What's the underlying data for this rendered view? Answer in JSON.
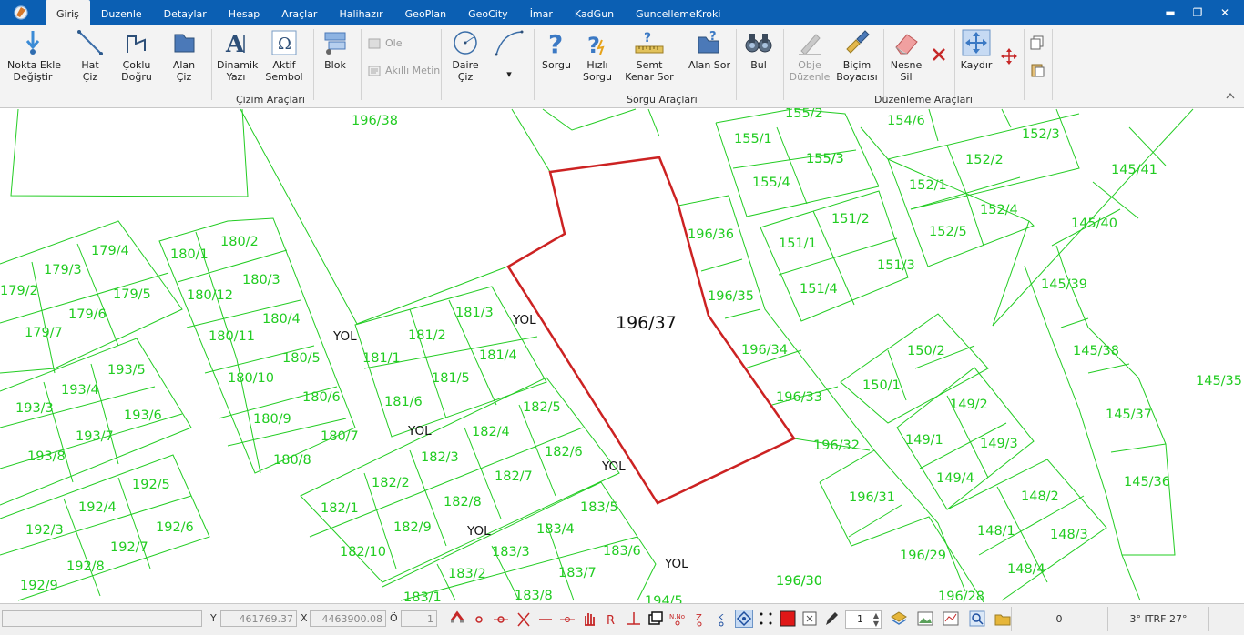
{
  "menu": {
    "tabs": [
      "Giriş",
      "Duzenle",
      "Detaylar",
      "Hesap",
      "Araçlar",
      "Halihazır",
      "GeoPlan",
      "GeoCity",
      "İmar",
      "KadGun",
      "GuncellemeKroki"
    ]
  },
  "ribbon": {
    "nokta_ekle": "Nokta Ekle\nDeğiştir",
    "hat_ciz": "Hat\nÇiz",
    "coklu_dogru": "Çoklu\nDoğru",
    "alan_ciz": "Alan\nÇiz",
    "dinamik_yazi": "Dinamik\nYazı",
    "aktif_sembol": "Aktif\nSembol",
    "blok": "Blok",
    "ole": "Ole",
    "akilli_metin": "Akıllı Metin",
    "daire_ciz": "Daire\nÇiz",
    "sorgu": "Sorgu",
    "hizli_sorgu": "Hızlı\nSorgu",
    "semt_kenar_sor": "Semt\nKenar Sor",
    "alan_sor": "Alan Sor",
    "bul": "Bul",
    "obje_duzenle": "Obje\nDüzenle",
    "bicim_boyacisi": "Biçim\nBoyacısı",
    "nesne_sil": "Nesne\nSil",
    "kaydir": "Kaydır",
    "group_cizim": "Çizim Araçları",
    "group_sorgu": "Sorgu Araçları",
    "group_duzenleme": "Düzenleme Araçları"
  },
  "map": {
    "parcel_color": "#22cc22",
    "highlight_color": "#cc2222",
    "selected_label": "196/37",
    "road_labels": [
      "YOL",
      "YOL",
      "YOL",
      "YOL",
      "YOL",
      "YOL"
    ],
    "parcel_labels": [
      "196/38",
      "155/2",
      "154/6",
      "155/1",
      "152/3",
      "155/3",
      "152/2",
      "155/4",
      "152/1",
      "145/41",
      "196/36",
      "151/2",
      "152/4",
      "145/40",
      "151/1",
      "152/5",
      "151/3",
      "196/35",
      "145/39",
      "151/4",
      "150/2",
      "196/34",
      "145/38",
      "150/1",
      "196/33",
      "149/2",
      "145/37",
      "149/1",
      "149/3",
      "196/32",
      "145/36",
      "149/4",
      "196/31",
      "148/2",
      "148/1",
      "148/3",
      "196/29",
      "148/4",
      "196/30",
      "196/28",
      "145/35",
      "180/1",
      "180/2",
      "179/4",
      "179/3",
      "180/3",
      "179/2",
      "179/5",
      "180/12",
      "179/6",
      "180/4",
      "180/11",
      "179/7",
      "181/3",
      "181/2",
      "181/1",
      "181/4",
      "180/5",
      "193/5",
      "180/10",
      "181/5",
      "193/4",
      "180/6",
      "181/6",
      "193/3",
      "193/6",
      "182/5",
      "180/9",
      "182/4",
      "193/7",
      "180/7",
      "182/6",
      "193/8",
      "180/8",
      "182/3",
      "192/5",
      "182/2",
      "182/7",
      "182/1",
      "192/4",
      "182/8",
      "183/5",
      "192/6",
      "192/3",
      "182/9",
      "183/4",
      "192/7",
      "182/10",
      "183/6",
      "183/3",
      "192/8",
      "183/2",
      "183/7",
      "192/9",
      "183/1",
      "183/8",
      "194/5",
      "196/30",
      "155/3"
    ]
  },
  "statusbar": {
    "y_label": "Y",
    "y_value": "461769.37",
    "x_label": "X",
    "x_value": "4463900.08",
    "o_label": "Ö",
    "o_value": "1",
    "scale_value": "1",
    "count": "0",
    "projection": "3° ITRF 27°"
  }
}
